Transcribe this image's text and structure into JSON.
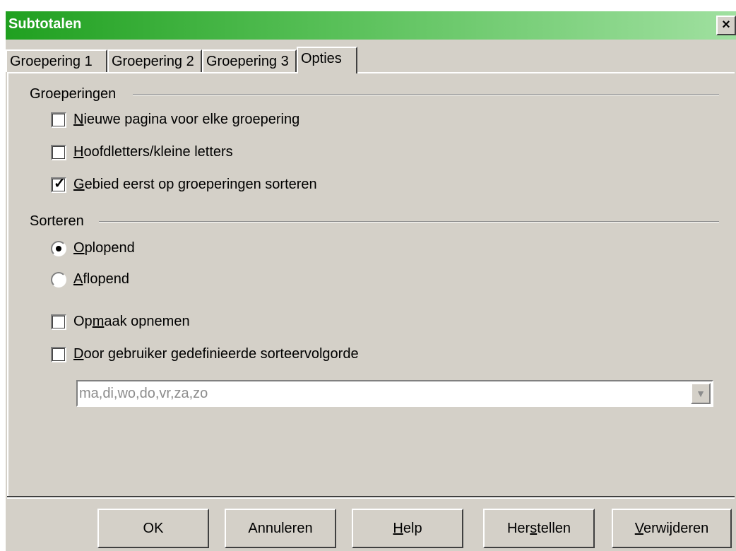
{
  "window": {
    "title": "Subtotalen",
    "close_label": "×"
  },
  "tabs": [
    {
      "label": "Groepering 1",
      "active": false
    },
    {
      "label": "Groepering 2",
      "active": false
    },
    {
      "label": "Groepering 3",
      "active": false
    },
    {
      "label": "Opties",
      "active": true
    }
  ],
  "groeperingen": {
    "label": "Groeperingen",
    "options": [
      {
        "pre": "",
        "key": "N",
        "post": "ieuwe pagina voor elke groepering",
        "checked": false
      },
      {
        "pre": "",
        "key": "H",
        "post": "oofdletters/kleine letters",
        "checked": false
      },
      {
        "pre": "",
        "key": "G",
        "post": "ebied eerst op groeperingen sorteren",
        "checked": true
      }
    ]
  },
  "sorteren": {
    "label": "Sorteren",
    "radios": [
      {
        "pre": "",
        "key": "O",
        "post": "plopend",
        "selected": true
      },
      {
        "pre": "",
        "key": "A",
        "post": "flopend",
        "selected": false
      }
    ],
    "options": [
      {
        "pre": "Op",
        "key": "m",
        "post": "aak opnemen",
        "checked": false
      },
      {
        "pre": "",
        "key": "D",
        "post": "oor gebruiker gedefinieerde sorteervolgorde",
        "checked": false
      }
    ],
    "sort_order_value": "ma,di,wo,do,vr,za,zo"
  },
  "buttons": [
    {
      "pre": "OK",
      "key": "",
      "post": ""
    },
    {
      "pre": "Annuleren",
      "key": "",
      "post": ""
    },
    {
      "pre": "",
      "key": "H",
      "post": "elp"
    },
    {
      "pre": "Her",
      "key": "s",
      "post": "tellen"
    },
    {
      "pre": "",
      "key": "V",
      "post": "erwijderen"
    }
  ],
  "colors": {
    "titlebar_start": "#20a020",
    "titlebar_end": "#a0e0a0",
    "dialog_bg": "#d4d0c8"
  }
}
